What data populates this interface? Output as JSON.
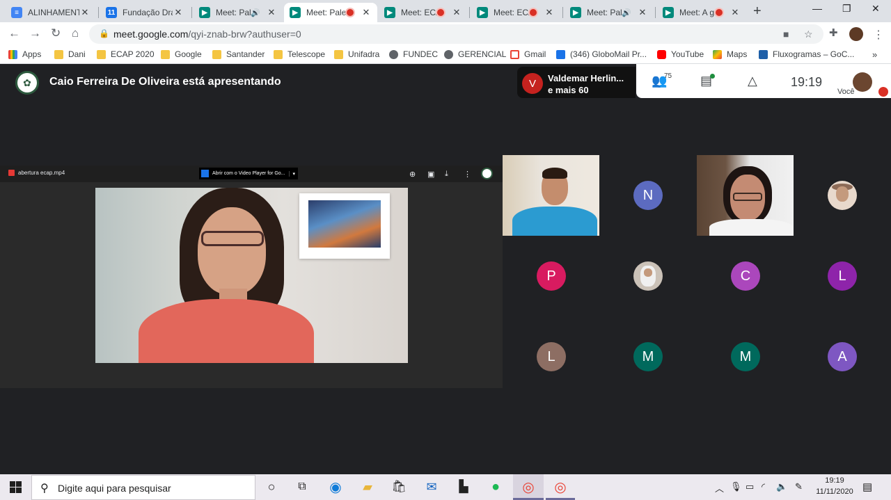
{
  "browser": {
    "tabs": [
      {
        "title": "ALINHAMENTO",
        "favicon": "google-docs-icon",
        "indicator": "none",
        "active": false
      },
      {
        "title": "Fundação Dra",
        "favicon": "google-calendar-icon",
        "indicator": "none",
        "active": false
      },
      {
        "title": "Meet: Pale",
        "favicon": "google-meet-icon",
        "indicator": "audio",
        "active": false
      },
      {
        "title": "Meet: Pale",
        "favicon": "google-meet-icon",
        "indicator": "recording",
        "active": true
      },
      {
        "title": "Meet: ECA",
        "favicon": "google-meet-icon",
        "indicator": "recording",
        "active": false
      },
      {
        "title": "Meet: ECA",
        "favicon": "google-meet-icon",
        "indicator": "recording",
        "active": false
      },
      {
        "title": "Meet: Pale",
        "favicon": "google-meet-icon",
        "indicator": "audio",
        "active": false
      },
      {
        "title": "Meet: A gr",
        "favicon": "google-meet-icon",
        "indicator": "recording",
        "active": false
      }
    ],
    "url_host": "meet.google.com",
    "url_path": "/qyi-znab-brw?authuser=0",
    "bookmarks": [
      {
        "label": "Apps",
        "icon": "apps-grid-icon"
      },
      {
        "label": "Dani",
        "icon": "folder-icon"
      },
      {
        "label": "ECAP 2020",
        "icon": "folder-icon"
      },
      {
        "label": "Google",
        "icon": "folder-icon"
      },
      {
        "label": "Santander",
        "icon": "folder-icon"
      },
      {
        "label": "Telescope",
        "icon": "folder-icon"
      },
      {
        "label": "Unifadra",
        "icon": "folder-icon"
      },
      {
        "label": "FUNDEC",
        "icon": "globe-icon"
      },
      {
        "label": "GERENCIAL",
        "icon": "globe-icon"
      },
      {
        "label": "Gmail",
        "icon": "gmail-icon"
      },
      {
        "label": "(346) GloboMail Pr...",
        "icon": "globomail-icon"
      },
      {
        "label": "YouTube",
        "icon": "youtube-icon"
      },
      {
        "label": "Maps",
        "icon": "maps-icon"
      },
      {
        "label": "Fluxogramas – GoC...",
        "icon": "fluxogramas-icon"
      }
    ]
  },
  "meet": {
    "presenter_text": "Caio Ferreira De Oliveira está apresentando",
    "speaker": {
      "initial": "V",
      "name": "Valdemar Herlin...",
      "others": "e mais 60"
    },
    "participant_count": "75",
    "time": "19:19",
    "self_label": "Você",
    "presentation": {
      "file_name": "abertura ecap.mp4",
      "open_with": "Abrir com o Video Player for Go..."
    },
    "participants": [
      {
        "type": "camera",
        "variant": "cam1"
      },
      {
        "type": "initial",
        "initial": "N",
        "color": "#5c6bc0"
      },
      {
        "type": "camera",
        "variant": "cam2"
      },
      {
        "type": "photo",
        "variant": "photo"
      },
      {
        "type": "initial",
        "initial": "P",
        "color": "#d81b60"
      },
      {
        "type": "photo",
        "variant": "photo2"
      },
      {
        "type": "initial",
        "initial": "C",
        "color": "#ab47bc"
      },
      {
        "type": "initial",
        "initial": "L",
        "color": "#8e24aa"
      },
      {
        "type": "initial",
        "initial": "L",
        "color": "#8d6e63"
      },
      {
        "type": "initial",
        "initial": "M",
        "color": "#00695c"
      },
      {
        "type": "initial",
        "initial": "M",
        "color": "#00695c"
      },
      {
        "type": "initial",
        "initial": "A",
        "color": "#7e57c2"
      }
    ]
  },
  "taskbar": {
    "search_placeholder": "Digite aqui para pesquisar",
    "time": "19:19",
    "date": "11/11/2020"
  }
}
